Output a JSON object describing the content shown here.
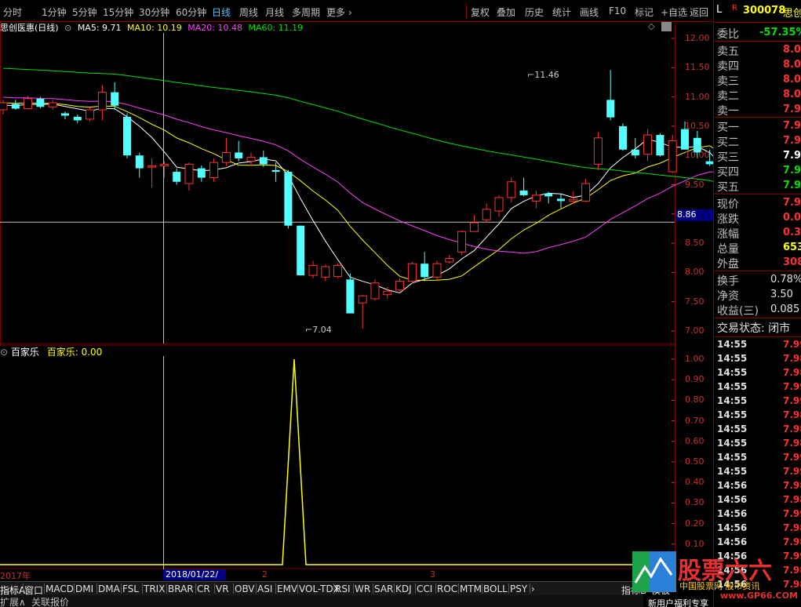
{
  "periods": [
    "分时",
    "1分钟",
    "5分钟",
    "15分钟",
    "30分钟",
    "60分钟",
    "日线",
    "周线",
    "月线",
    "多周期",
    "更多 ›"
  ],
  "active_period": "日线",
  "toolbar": [
    "复权",
    "叠加",
    "历史",
    "统计",
    "画线",
    "F10",
    "标记",
    "+自选",
    "返回"
  ],
  "stock_name": "思创医惠(日线)",
  "ma": [
    {
      "label": "MA5: 9.71",
      "color": "#ffffff"
    },
    {
      "label": "MA10: 10.19",
      "color": "#ffff00"
    },
    {
      "label": "MA20: 10.48",
      "color": "#ff40ff"
    },
    {
      "label": "MA60: 11.19",
      "color": "#00e000"
    }
  ],
  "price_axis": [
    "12.00",
    "11.50",
    "11.00",
    "10.50",
    "10.00",
    "9.50",
    "9.00",
    "8.50",
    "8.00",
    "7.50",
    "7.00"
  ],
  "crosshair_price": "8.86",
  "high_label": "11.46",
  "low_label": "7.04",
  "sub_title": "百家乐",
  "sub_value": "百家乐: 0.00",
  "sub_axis": [
    "1.00",
    "0.90",
    "0.80",
    "0.70",
    "0.60",
    "0.50",
    "0.40",
    "0.30",
    "0.20",
    "0.10"
  ],
  "x_axis": {
    "year": "2017年",
    "cursor": "2018/01/22/—",
    "m2": "2",
    "m3": "3"
  },
  "indicators": [
    "指标A",
    "窗口",
    "MACD",
    "DMI",
    "DMA",
    "FSL",
    "TRIX",
    "BRAR",
    "CR",
    "VR",
    "OBV",
    "ASI",
    "EMV",
    "VOL-TDX",
    "RSI",
    "WR",
    "SAR",
    "KDJ",
    "CCI",
    "ROC",
    "MTM",
    "BOLL",
    "PSY",
    "›"
  ],
  "ind_right": "指标B",
  "ind_tab": "模板",
  "bottom": [
    "扩展∧",
    "关联报价"
  ],
  "side": {
    "flag": "L",
    "r": "R",
    "code": "300078",
    "name": "思创",
    "weibi_label": "委比",
    "weibi_val": "-57.35%",
    "asks": [
      {
        "l": "卖五",
        "v": "8.01"
      },
      {
        "l": "卖四",
        "v": "8.01"
      },
      {
        "l": "卖三",
        "v": "8.01"
      },
      {
        "l": "卖二",
        "v": "8.00"
      },
      {
        "l": "卖一",
        "v": "7.99"
      }
    ],
    "bids": [
      {
        "l": "买一",
        "v": "7.98",
        "c": "#ff3030"
      },
      {
        "l": "买二",
        "v": "7.97",
        "c": "#ff3030"
      },
      {
        "l": "买三",
        "v": "7.96",
        "c": "#ffffff"
      },
      {
        "l": "买四",
        "v": "7.95",
        "c": "#00e000"
      },
      {
        "l": "买五",
        "v": "7.94",
        "c": "#00e000"
      }
    ],
    "stats": [
      {
        "l": "现价",
        "v": "7.99",
        "c": "#ff3030"
      },
      {
        "l": "涨跌",
        "v": "0.03",
        "c": "#ff3030"
      },
      {
        "l": "涨幅",
        "v": "0.38%",
        "c": "#ff3030"
      },
      {
        "l": "总量",
        "v": "65329",
        "c": "#ffff00"
      },
      {
        "l": "外盘",
        "v": "30883",
        "c": "#ff3030"
      }
    ],
    "stats2": [
      {
        "l": "换手",
        "v": "0.78%",
        "c": "#e0e0e0"
      },
      {
        "l": "净资",
        "v": "3.50",
        "c": "#e0e0e0"
      },
      {
        "l": "收益(三)",
        "v": "0.085",
        "c": "#e0e0e0"
      }
    ],
    "status": "交易状态: 闭市",
    "ticks": [
      [
        "14:55",
        "7.99"
      ],
      [
        "14:55",
        "7.98"
      ],
      [
        "14:55",
        "7.98"
      ],
      [
        "14:55",
        "7.99"
      ],
      [
        "14:55",
        "7.99"
      ],
      [
        "14:55",
        "7.98"
      ],
      [
        "14:55",
        "7.98"
      ],
      [
        "14:55",
        "7.98"
      ],
      [
        "14:55",
        "7.99"
      ],
      [
        "14:55",
        "7.99"
      ],
      [
        "14:56",
        "7.98"
      ],
      [
        "14:56",
        "7.98"
      ],
      [
        "14:56",
        "7.99"
      ],
      [
        "14:56",
        "7.98"
      ],
      [
        "14:56",
        "7.98"
      ],
      [
        "14:56",
        "7.99"
      ],
      [
        "14:56",
        "7.98"
      ],
      [
        "14:56",
        "7.98"
      ]
    ],
    "promo": "新用户福利专享"
  },
  "logo": {
    "text": "股票六六",
    "sub": "中国股票网 股市资讯",
    "url": "www.GP66.COM"
  },
  "chart_data": {
    "type": "candlestick",
    "ylim": [
      6.9,
      12.2
    ],
    "candles": [
      [
        10.78,
        10.95,
        10.7,
        10.9
      ],
      [
        10.88,
        10.95,
        10.78,
        10.8
      ],
      [
        10.8,
        11.02,
        10.78,
        10.97
      ],
      [
        10.97,
        11.0,
        10.8,
        10.83
      ],
      [
        10.83,
        10.95,
        10.78,
        10.9
      ],
      [
        10.72,
        10.75,
        10.62,
        10.68
      ],
      [
        10.66,
        10.7,
        10.55,
        10.6
      ],
      [
        10.62,
        10.82,
        10.58,
        10.78
      ],
      [
        10.78,
        11.2,
        10.6,
        11.08
      ],
      [
        11.08,
        11.25,
        10.78,
        10.85
      ],
      [
        10.66,
        10.72,
        9.95,
        10.0
      ],
      [
        10.0,
        10.05,
        9.62,
        9.78
      ],
      [
        9.8,
        9.95,
        9.45,
        9.82
      ],
      [
        9.82,
        9.9,
        9.62,
        9.85
      ],
      [
        9.72,
        9.78,
        9.5,
        9.55
      ],
      [
        9.52,
        9.88,
        9.4,
        9.85
      ],
      [
        9.78,
        9.83,
        9.55,
        9.62
      ],
      [
        9.62,
        9.95,
        9.55,
        9.88
      ],
      [
        9.88,
        10.3,
        9.82,
        10.05
      ],
      [
        10.05,
        10.25,
        9.9,
        9.95
      ],
      [
        9.9,
        10.05,
        9.82,
        9.97
      ],
      [
        9.97,
        10.08,
        9.8,
        9.85
      ],
      [
        9.75,
        9.88,
        9.55,
        9.72
      ],
      [
        9.72,
        9.75,
        8.75,
        8.8
      ],
      [
        8.8,
        8.8,
        7.95,
        7.95
      ],
      [
        7.95,
        8.2,
        7.9,
        8.12
      ],
      [
        7.92,
        8.13,
        7.85,
        8.1
      ],
      [
        7.93,
        8.15,
        7.9,
        8.12
      ],
      [
        7.88,
        7.98,
        7.32,
        7.3
      ],
      [
        7.48,
        7.62,
        7.04,
        7.6
      ],
      [
        7.55,
        7.88,
        7.52,
        7.82
      ],
      [
        7.62,
        7.75,
        7.55,
        7.68
      ],
      [
        7.7,
        7.9,
        7.65,
        7.85
      ],
      [
        7.85,
        8.18,
        7.8,
        8.15
      ],
      [
        8.15,
        8.35,
        7.85,
        7.92
      ],
      [
        7.92,
        8.2,
        7.85,
        8.15
      ],
      [
        8.18,
        8.3,
        8.15,
        8.24
      ],
      [
        8.35,
        8.72,
        8.3,
        8.7
      ],
      [
        8.7,
        8.98,
        8.7,
        8.85
      ],
      [
        8.9,
        9.18,
        8.85,
        9.08
      ],
      [
        9.05,
        9.32,
        8.95,
        9.28
      ],
      [
        9.28,
        9.62,
        9.2,
        9.55
      ],
      [
        9.4,
        9.62,
        9.3,
        9.32
      ],
      [
        9.22,
        9.4,
        9.1,
        9.32
      ],
      [
        9.35,
        9.38,
        9.18,
        9.3
      ],
      [
        9.26,
        9.35,
        9.1,
        9.22
      ],
      [
        9.22,
        9.38,
        9.18,
        9.25
      ],
      [
        9.22,
        9.6,
        9.2,
        9.52
      ],
      [
        9.85,
        10.4,
        9.75,
        10.3
      ],
      [
        10.95,
        11.46,
        10.6,
        10.65
      ],
      [
        10.5,
        10.55,
        10.08,
        10.1
      ],
      [
        10.1,
        10.3,
        9.95,
        10.0
      ],
      [
        10.02,
        10.45,
        9.9,
        10.35
      ],
      [
        10.35,
        10.38,
        9.98,
        10.0
      ],
      [
        9.72,
        10.35,
        9.7,
        10.25
      ],
      [
        10.45,
        10.58,
        10.1,
        10.1
      ],
      [
        10.3,
        10.42,
        9.95,
        10.05
      ],
      [
        9.9,
        10.1,
        9.82,
        9.85
      ],
      [
        9.6,
        9.65,
        8.85,
        8.9
      ],
      [
        9.28,
        9.32,
        8.08,
        8.1
      ],
      [
        9.35,
        10.18,
        9.3,
        10.15
      ],
      [
        9.95,
        10.38,
        9.85,
        10.32
      ],
      [
        10.38,
        10.55,
        10.2,
        10.4
      ],
      [
        10.45,
        11.28,
        10.4,
        10.98
      ]
    ]
  }
}
